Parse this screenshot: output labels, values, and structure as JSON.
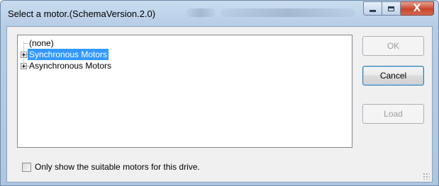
{
  "window": {
    "title": "Select a motor.(SchemaVersion.2.0)"
  },
  "titlebar": {
    "minimize_icon": "minimize-icon",
    "maximize_icon": "maximize-icon",
    "close_icon": "close-icon",
    "close_glyph": "X"
  },
  "tree": {
    "items": [
      {
        "label": "(none)",
        "expandable": false,
        "selected": false
      },
      {
        "label": "Synchronous Motors",
        "expandable": true,
        "selected": true
      },
      {
        "label": "Asynchronous Motors",
        "expandable": true,
        "selected": false
      }
    ]
  },
  "buttons": {
    "ok": "OK",
    "cancel": "Cancel",
    "load": "Load"
  },
  "filter": {
    "label": "Only show the suitable motors for this drive.",
    "checked": false
  },
  "colors": {
    "selection": "#3399ff",
    "close_button": "#c8442b"
  }
}
